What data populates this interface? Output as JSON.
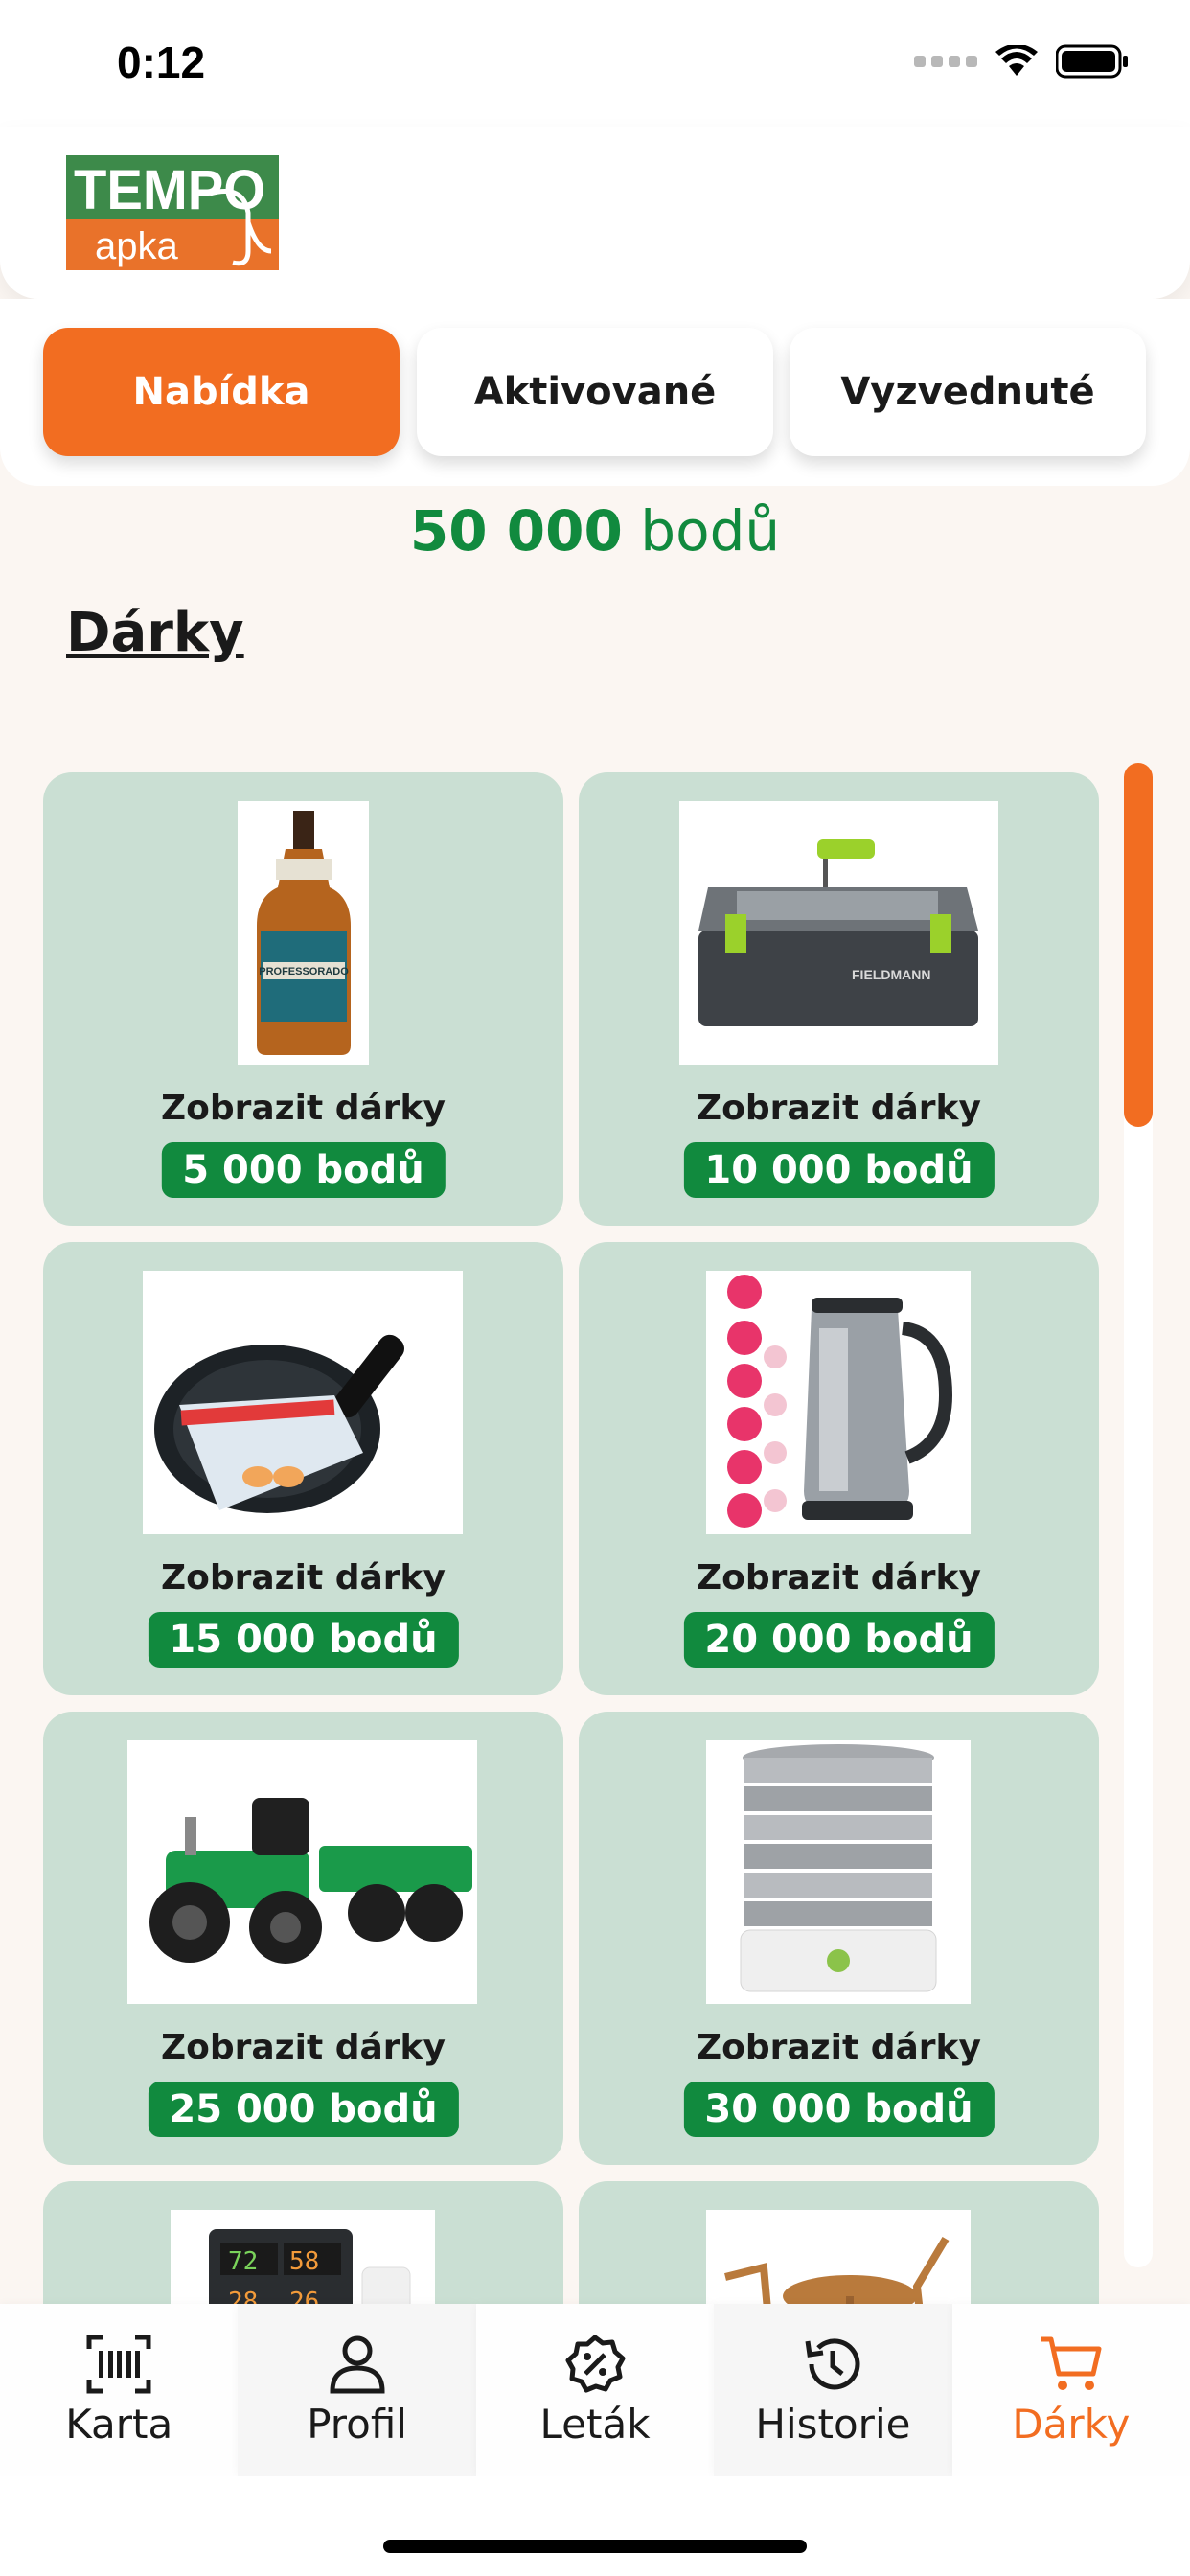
{
  "status": {
    "time": "0:12"
  },
  "brand": {
    "logo_top": "TEMPO",
    "logo_bottom": "apka",
    "green": "#3d8a4a",
    "orange": "#e9722a"
  },
  "tabs": [
    {
      "label": "Nabídka",
      "active": true
    },
    {
      "label": "Aktivované",
      "active": false
    },
    {
      "label": "Vyzvednuté",
      "active": false
    }
  ],
  "points": {
    "value": "50 000",
    "unit": "bodů"
  },
  "section_title": "Dárky",
  "gifts": [
    {
      "label": "Zobrazit dárky",
      "points": "5 000 bodů",
      "icon": "rum-bottle-image"
    },
    {
      "label": "Zobrazit dárky",
      "points": "10 000 bodů",
      "icon": "toolbox-image"
    },
    {
      "label": "Zobrazit dárky",
      "points": "15 000 bodů",
      "icon": "frying-pan-image"
    },
    {
      "label": "Zobrazit dárky",
      "points": "20 000 bodů",
      "icon": "kettle-image"
    },
    {
      "label": "Zobrazit dárky",
      "points": "25 000 bodů",
      "icon": "toy-tractor-image"
    },
    {
      "label": "Zobrazit dárky",
      "points": "30 000 bodů",
      "icon": "food-dehydrator-image"
    },
    {
      "icon": "weather-station-image"
    },
    {
      "icon": "garden-furniture-image"
    }
  ],
  "nav": [
    {
      "label": "Karta",
      "icon": "barcode-scan-icon"
    },
    {
      "label": "Profil",
      "icon": "user-icon"
    },
    {
      "label": "Leták",
      "icon": "discount-badge-icon"
    },
    {
      "label": "Historie",
      "icon": "history-icon"
    },
    {
      "label": "Dárky",
      "icon": "cart-icon",
      "active": true
    }
  ],
  "colors": {
    "accent": "#f26d21",
    "points_green": "#118a3e",
    "card_bg": "#cadfd3"
  }
}
